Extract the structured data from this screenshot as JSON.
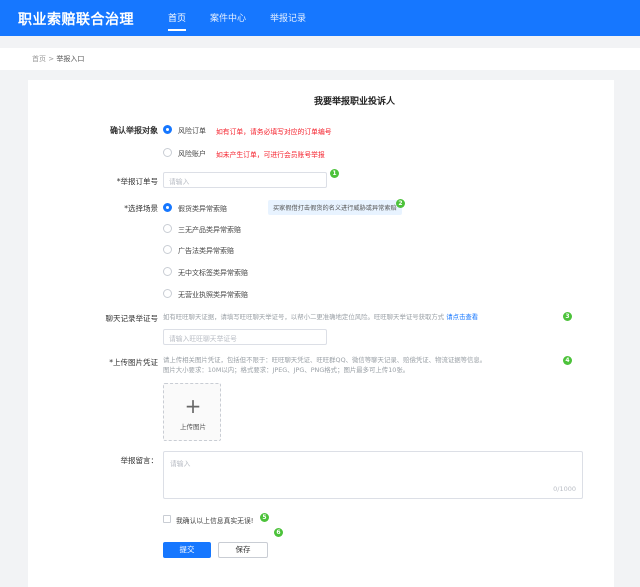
{
  "header": {
    "brand": "职业索赔联合治理",
    "nav": [
      "首页",
      "案件中心",
      "举报记录"
    ]
  },
  "breadcrumb": {
    "home": "首页",
    "sep": ">",
    "current": "举报入口"
  },
  "form": {
    "title": "我要举报职业投诉人",
    "target_label": "确认举报对象",
    "target_options": [
      {
        "label": "风险订单",
        "hint": "如有订单，请务必填写对应的订单编号"
      },
      {
        "label": "风险账户",
        "hint": "如未产生订单，可进行会员账号举报"
      }
    ],
    "order_label": "*举报订单号",
    "order_placeholder": "请输入",
    "scene_label": "*选择场景",
    "scene_options": [
      "假货类异常索赔",
      "三无产品类异常索赔",
      "广告法类异常索赔",
      "无中文标签类异常索赔",
      "无营业执照类异常索赔"
    ],
    "scene_tip": "买家假借打击假货的名义进行威胁或异常索赔",
    "chat_label": "聊天记录举证号",
    "chat_hint_a": "如有旺旺聊天证据，请填写旺旺聊天举证号，以帮小二更准确地定位风险。旺旺聊天举证号获取方式",
    "chat_hint_link": "请点击查看",
    "chat_placeholder": "请输入旺旺聊天举证号",
    "upload_label": "*上传图片凭证",
    "upload_hint_1": "请上传相关图片凭证，包括但不限于：旺旺聊天凭证、旺旺群QQ、微信等聊天记录、赔偿凭证、物流证据等信息。",
    "upload_hint_2": "图片大小要求：10M以内；格式要求：JPEG、JPG、PNG格式；图片最多可上传10张。",
    "upload_button": "上传图片",
    "message_label": "举报留言：",
    "message_placeholder": "请输入",
    "message_count": "0/1000",
    "confirm_text": "我确认以上信息真实无误!",
    "submit_label": "提交",
    "save_label": "保存",
    "badges": [
      "1",
      "2",
      "3",
      "4",
      "5",
      "6"
    ]
  },
  "colors": {
    "primary": "#1677ff",
    "danger": "#f5222d",
    "badge": "#4cc23a"
  }
}
